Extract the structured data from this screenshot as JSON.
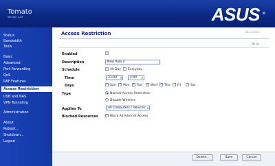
{
  "header": {
    "title": "Tomato",
    "version": "Version 1.25",
    "logo": "ASUS",
    "logo_mark": "®"
  },
  "sidebar": {
    "items": [
      {
        "label": "Status"
      },
      {
        "label": "Bandwidth"
      },
      {
        "label": "Tools"
      },
      {
        "label": "Basic"
      },
      {
        "label": "Advanced"
      },
      {
        "label": "Port Forwarding"
      },
      {
        "label": "QoS"
      },
      {
        "label": "RAF Features"
      },
      {
        "label": "Access Restriction"
      },
      {
        "label": "USB and NAS"
      },
      {
        "label": "VPN Tunneling"
      },
      {
        "label": "Administration"
      },
      {
        "label": "About"
      },
      {
        "label": "Reboot..."
      },
      {
        "label": "Shutdown..."
      },
      {
        "label": "Logout"
      }
    ],
    "active": "Access Restriction"
  },
  "page": {
    "title": "Access Restriction",
    "top_right": "BE-ASUS9A",
    "rule_id": "ID: 01"
  },
  "form": {
    "enabled_label": "Enabled",
    "description_label": "Description",
    "description_value": "New Rule 2",
    "schedule_label": "Schedule",
    "all_day": "All Day",
    "everyday": "Everyday",
    "time_label": "Time",
    "time_from": "23:00",
    "time_sep": "-",
    "time_to": "4:00",
    "days_label": "Days",
    "days": [
      {
        "label": "Sun",
        "checked": true
      },
      {
        "label": "Mon",
        "checked": true
      },
      {
        "label": "Tue",
        "checked": true
      },
      {
        "label": "Wed",
        "checked": true
      },
      {
        "label": "Thu",
        "checked": true
      },
      {
        "label": "Fri",
        "checked": false
      },
      {
        "label": "Sat",
        "checked": false
      }
    ],
    "type_label": "Type",
    "type_normal": "Normal Access Restriction",
    "type_disable": "Disable Wireless",
    "applies_label": "Applies To",
    "applies_value": "All Computers / Devices",
    "blocked_label": "Blocked Resources",
    "blocked_value": "Block All Internet Access"
  },
  "buttons": {
    "delete": "Delete...",
    "save": "Save",
    "cancel": "Cancel"
  }
}
